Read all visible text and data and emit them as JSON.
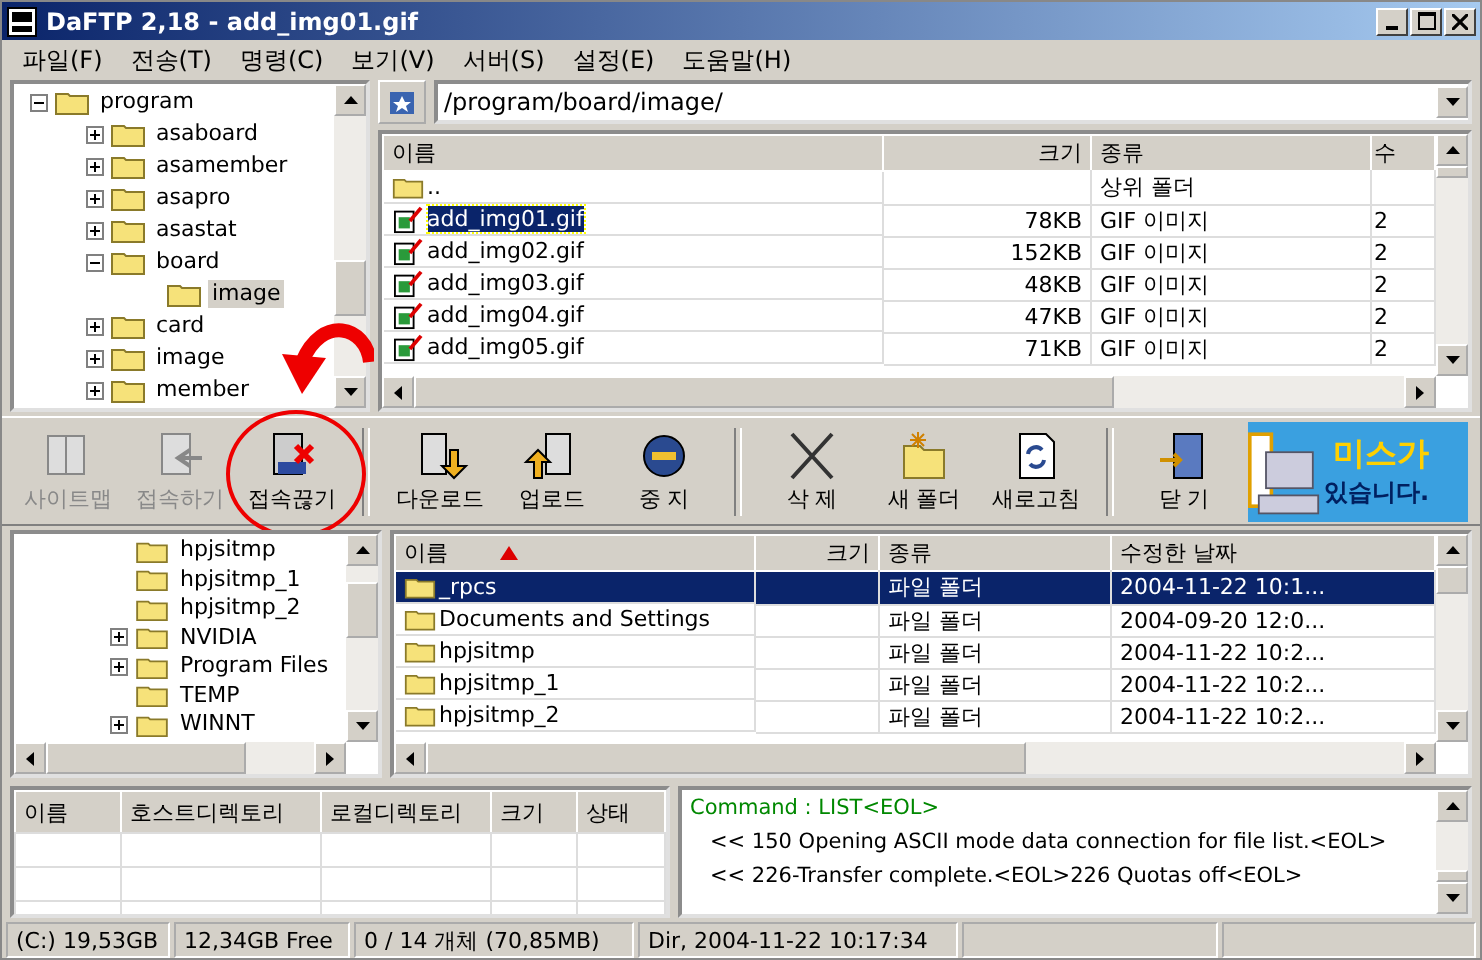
{
  "window": {
    "title": "DaFTP 2,18 - add_img01.gif"
  },
  "menu": [
    "파일(F)",
    "전송(T)",
    "명령(C)",
    "보기(V)",
    "서버(S)",
    "설정(E)",
    "도움말(H)"
  ],
  "remote_tree": [
    {
      "label": "program",
      "expandable": true,
      "expanded": true,
      "selected": false,
      "children": [
        {
          "label": "asaboard",
          "expandable": true,
          "expanded": false,
          "selected": false
        },
        {
          "label": "asamember",
          "expandable": true,
          "expanded": false,
          "selected": false
        },
        {
          "label": "asapro",
          "expandable": true,
          "expanded": false,
          "selected": false
        },
        {
          "label": "asastat",
          "expandable": true,
          "expanded": false,
          "selected": false
        },
        {
          "label": "board",
          "expandable": true,
          "expanded": true,
          "selected": false,
          "children": [
            {
              "label": "image",
              "expandable": false,
              "selected": true
            }
          ]
        },
        {
          "label": "card",
          "expandable": true,
          "expanded": false,
          "selected": false
        },
        {
          "label": "image",
          "expandable": true,
          "expanded": false,
          "selected": false
        },
        {
          "label": "member",
          "expandable": true,
          "expanded": false,
          "selected": false
        }
      ]
    }
  ],
  "remote_path": "/program/board/image/",
  "remote_list": {
    "columns": [
      "이름",
      "크기",
      "종류",
      "수"
    ],
    "rows": [
      {
        "kind": "folder",
        "name": "..",
        "size": "",
        "type": "상위 폴더",
        "column_4": "",
        "selected": false
      },
      {
        "kind": "file",
        "name": "add_img01.gif",
        "size": "78KB",
        "type": "GIF 이미지",
        "column_4": "2",
        "selected": true
      },
      {
        "kind": "file",
        "name": "add_img02.gif",
        "size": "152KB",
        "type": "GIF 이미지",
        "column_4": "2",
        "selected": false
      },
      {
        "kind": "file",
        "name": "add_img03.gif",
        "size": "48KB",
        "type": "GIF 이미지",
        "column_4": "2",
        "selected": false
      },
      {
        "kind": "file",
        "name": "add_img04.gif",
        "size": "47KB",
        "type": "GIF 이미지",
        "column_4": "2",
        "selected": false
      },
      {
        "kind": "file",
        "name": "add_img05.gif",
        "size": "71KB",
        "type": "GIF 이미지",
        "column_4": "2",
        "selected": false
      }
    ]
  },
  "toolbar": [
    {
      "label": "사이트맵",
      "disabled": true,
      "highlighted": false,
      "separator_before": false
    },
    {
      "label": "접속하기",
      "disabled": true,
      "highlighted": false,
      "separator_before": false
    },
    {
      "label": "접속끊기",
      "disabled": false,
      "highlighted": true,
      "separator_before": false
    },
    {
      "label": "다운로드",
      "disabled": false,
      "highlighted": false,
      "separator_before": true
    },
    {
      "label": "업로드",
      "disabled": false,
      "highlighted": false,
      "separator_before": false
    },
    {
      "label": "중 지",
      "disabled": false,
      "highlighted": false,
      "separator_before": false
    },
    {
      "label": "삭 제",
      "disabled": false,
      "highlighted": false,
      "separator_before": true
    },
    {
      "label": "새 폴더",
      "disabled": false,
      "highlighted": false,
      "separator_before": false
    },
    {
      "label": "새로고침",
      "disabled": false,
      "highlighted": false,
      "separator_before": false
    },
    {
      "label": "닫 기",
      "disabled": false,
      "highlighted": false,
      "separator_before": true
    }
  ],
  "banner": {
    "line_1": "미스가",
    "line_2": "있습니다."
  },
  "local_tree": [
    {
      "label": "hpjsitmp",
      "expandable": false
    },
    {
      "label": "hpjsitmp_1",
      "expandable": false
    },
    {
      "label": "hpjsitmp_2",
      "expandable": false
    },
    {
      "label": "NVIDIA",
      "expandable": true
    },
    {
      "label": "Program Files",
      "expandable": true
    },
    {
      "label": "TEMP",
      "expandable": false
    },
    {
      "label": "WINNT",
      "expandable": true
    }
  ],
  "local_list": {
    "columns": [
      {
        "label": "이름",
        "sorted": true
      },
      {
        "label": "크기",
        "sorted": false
      },
      {
        "label": "종류",
        "sorted": false
      },
      {
        "label": "수정한 날짜",
        "sorted": false
      }
    ],
    "rows": [
      {
        "name": "_rpcs",
        "size": "",
        "type": "파일 폴더",
        "modified": "2004-11-22 10:1...",
        "selected": true
      },
      {
        "name": "Documents and Settings",
        "size": "",
        "type": "파일 폴더",
        "modified": "2004-09-20 12:0...",
        "selected": false
      },
      {
        "name": "hpjsitmp",
        "size": "",
        "type": "파일 폴더",
        "modified": "2004-11-22 10:2...",
        "selected": false
      },
      {
        "name": "hpjsitmp_1",
        "size": "",
        "type": "파일 폴더",
        "modified": "2004-11-22 10:2...",
        "selected": false
      },
      {
        "name": "hpjsitmp_2",
        "size": "",
        "type": "파일 폴더",
        "modified": "2004-11-22 10:2...",
        "selected": false
      }
    ]
  },
  "queue": {
    "columns": [
      "이름",
      "호스트디렉토리",
      "로컬디렉토리",
      "크기",
      "상태"
    ]
  },
  "log": [
    {
      "kind": "command",
      "text": "Command : LIST<EOL>"
    },
    {
      "kind": "reply",
      "text": "<< 150 Opening ASCII mode data connection for file list.<EOL>"
    },
    {
      "kind": "reply",
      "text": "<< 226-Transfer complete.<EOL>226 Quotas off<EOL>"
    }
  ],
  "status_bar": [
    "(C:) 19,53GB",
    "12,34GB Free",
    "0 / 14 개체 (70,85MB)",
    "Dir, 2004-11-22 10:17:34"
  ]
}
